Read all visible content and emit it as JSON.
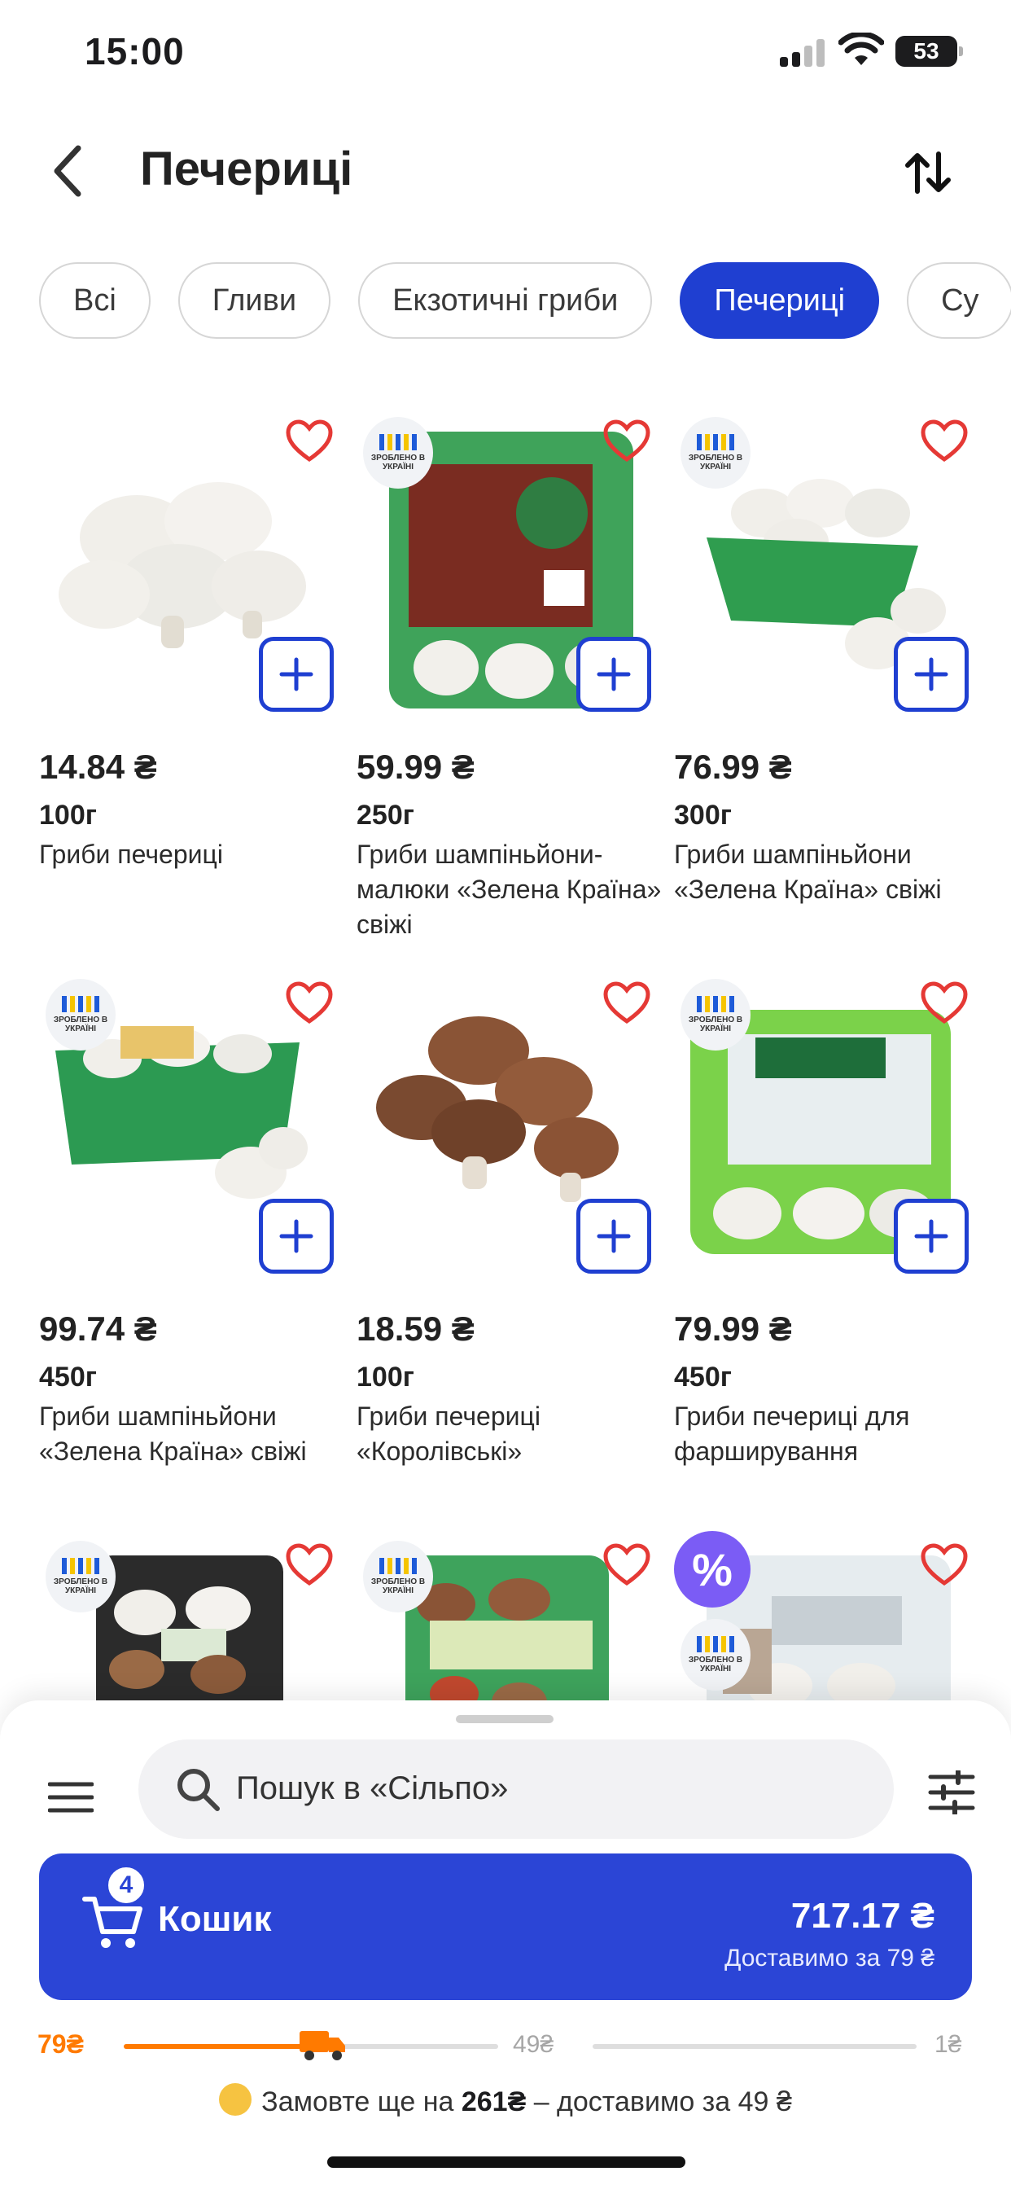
{
  "status": {
    "time": "15:00",
    "battery": "53"
  },
  "header": {
    "title": "Печериці"
  },
  "chips": [
    {
      "label": "Всі",
      "active": false
    },
    {
      "label": "Гливи",
      "active": false
    },
    {
      "label": "Екзотичні гриби",
      "active": false
    },
    {
      "label": "Печериці",
      "active": true
    },
    {
      "label": "Су",
      "active": false
    }
  ],
  "badge_ua_text": "ЗРОБЛЕНО В УКРАЇНІ",
  "products": [
    {
      "price": "14.84 ₴",
      "weight": "100г",
      "name": "Гриби печериці",
      "badge": "none",
      "image": "white-mushrooms"
    },
    {
      "price": "59.99 ₴",
      "weight": "250г",
      "name": "Гриби шампіньйони-малюки «Зелена Країна» свіжі",
      "badge": "made-in-ukraine",
      "image": "green-tray-package"
    },
    {
      "price": "76.99 ₴",
      "weight": "300г",
      "name": "Гриби шампіньйони «Зелена Країна» свіжі",
      "badge": "made-in-ukraine",
      "image": "green-tray-mushrooms"
    },
    {
      "price": "99.74 ₴",
      "weight": "450г",
      "name": "Гриби шампіньйони «Зелена Країна» свіжі",
      "badge": "made-in-ukraine",
      "image": "green-tray-mushrooms"
    },
    {
      "price": "18.59 ₴",
      "weight": "100г",
      "name": "Гриби печериці «Королівські»",
      "badge": "none",
      "image": "brown-mushrooms"
    },
    {
      "price": "79.99 ₴",
      "weight": "450г",
      "name": "Гриби печериці для фарширування",
      "badge": "made-in-ukraine",
      "image": "stuffing-package"
    },
    {
      "price": "",
      "weight": "",
      "name": "",
      "badge": "made-in-ukraine",
      "image": "black-tray-two-color"
    },
    {
      "price": "",
      "weight": "",
      "name": "",
      "badge": "made-in-ukraine",
      "image": "royal-brown-package"
    },
    {
      "price": "",
      "weight": "",
      "name": "",
      "badge": "promo",
      "image": "blanch-package"
    }
  ],
  "bottom": {
    "search_placeholder": "Пошук в «Сільпо»",
    "cart": {
      "count": "4",
      "label": "Кошик",
      "total": "717.17 ₴",
      "delivery": "Доставимо за 79 ₴"
    },
    "progress": {
      "start": "79₴",
      "mid": "49₴",
      "end": "1₴",
      "fill_fraction": 0.52
    },
    "hint": {
      "prefix": "Замовте ще на ",
      "amount": "261₴",
      "suffix": " – доставимо за 49 ₴"
    }
  },
  "colors": {
    "accent": "#1f3fd1",
    "cart": "#2b45d6",
    "progress": "#ff7a00",
    "heart": "#e53935",
    "promo": "#7b5cf5"
  }
}
